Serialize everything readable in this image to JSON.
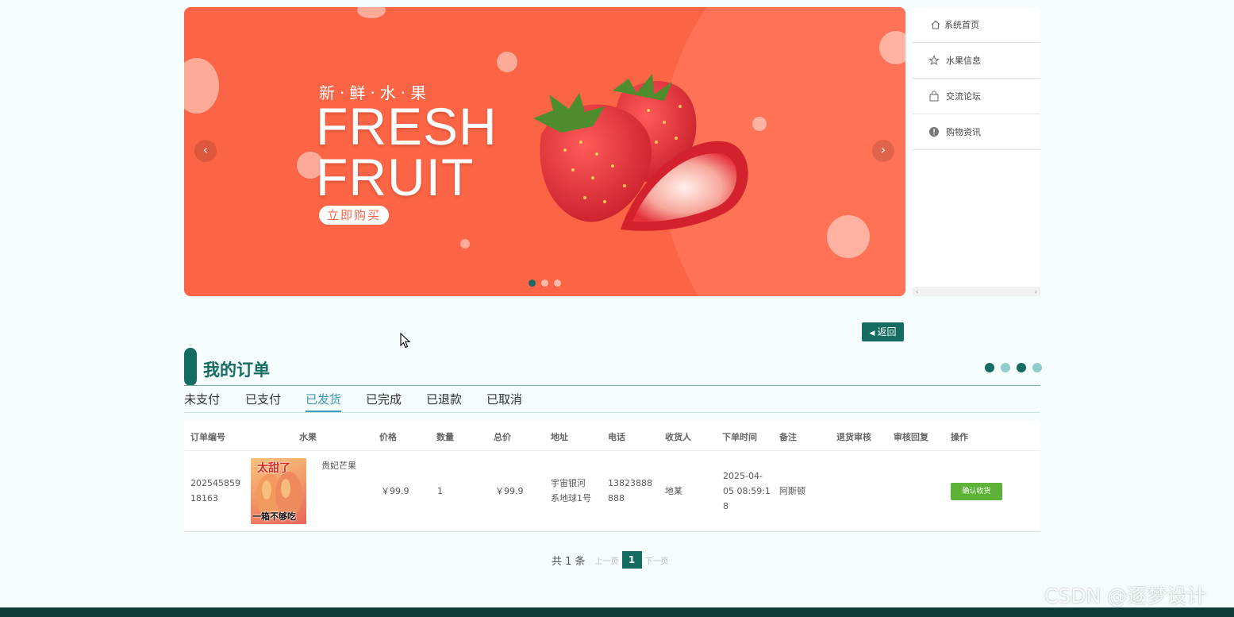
{
  "banner": {
    "tagline_cn": "新·鲜·水·果",
    "headline_line1": "FRESH",
    "headline_line2": "FRUIT",
    "buy_label": "立即购买",
    "prev_glyph": "‹",
    "next_glyph": "›",
    "slide_count": 3,
    "active_slide": 1
  },
  "side_menu": {
    "items": [
      {
        "label": "系统首页",
        "icon": "home-icon"
      },
      {
        "label": "水果信息",
        "icon": "star-icon"
      },
      {
        "label": "交流论坛",
        "icon": "bag-icon"
      },
      {
        "label": "购物资讯",
        "icon": "info-icon"
      }
    ],
    "scroll_left": "‹",
    "scroll_right": "›"
  },
  "back_button": {
    "label": "返回",
    "icon": "caret-left-icon"
  },
  "section": {
    "title": "我的订单",
    "accent": "#136b61",
    "dot_colors": [
      "#136b61",
      "#8fcccc",
      "#136b61",
      "#8fcccc"
    ]
  },
  "tabs": [
    {
      "label": "未支付",
      "active": false
    },
    {
      "label": "已支付",
      "active": false
    },
    {
      "label": "已发货",
      "active": true
    },
    {
      "label": "已完成",
      "active": false
    },
    {
      "label": "已退款",
      "active": false
    },
    {
      "label": "已取消",
      "active": false
    }
  ],
  "table": {
    "columns": [
      "订单编号",
      "水果",
      "价格",
      "数量",
      "总价",
      "地址",
      "电话",
      "收货人",
      "下单时间",
      "备注",
      "退货审核",
      "审核回复",
      "操作"
    ],
    "rows": [
      {
        "order_no_line1": "202545859",
        "order_no_line2": "18163",
        "fruit_name": "贵妃芒果",
        "thumb_text_top": "太甜了",
        "thumb_text_bottom": "一箱不够吃",
        "price": "￥99.9",
        "quantity": "1",
        "total": "￥99.9",
        "address_line1": "宇宙银河",
        "address_line2": "系地球1号",
        "phone_line1": "13823888",
        "phone_line2": "888",
        "receiver": "地某",
        "time_line1": "2025-04-",
        "time_line2": "05 08:59:1",
        "time_line3": "8",
        "remark": "阿斯顿",
        "refund_review": "",
        "review_reply": "",
        "action_label": "确认收货"
      }
    ]
  },
  "pagination": {
    "total_text": "共 1 条",
    "prev_label": "上一页",
    "current_page": "1",
    "next_label": "下一页"
  },
  "watermark": "CSDN @逐梦设计",
  "colors": {
    "banner_bg": "#fb6444",
    "primary": "#136b61",
    "tab_active": "#3a98b8",
    "confirm_button": "#5cb338",
    "footer": "#0d3b37"
  }
}
